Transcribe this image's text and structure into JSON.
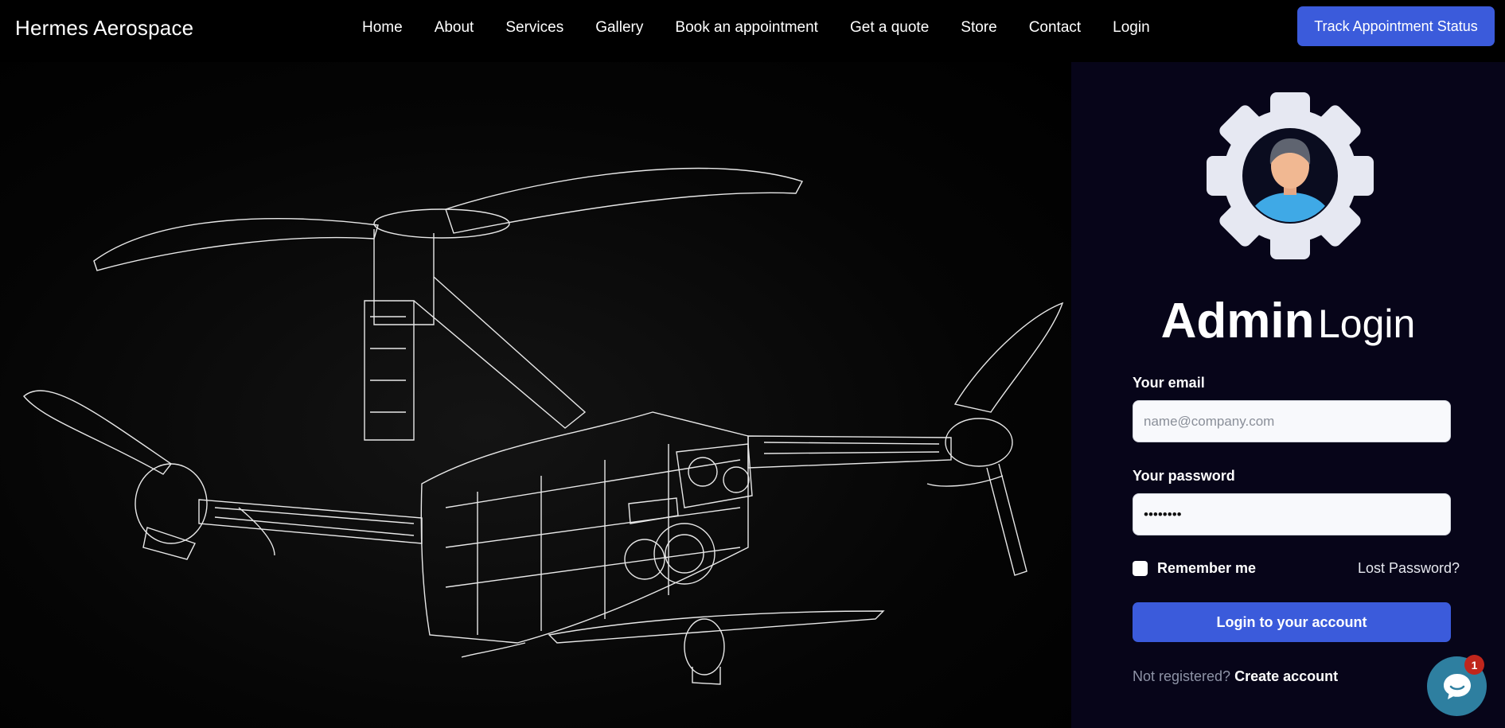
{
  "brand": "Hermes Aerospace",
  "nav": {
    "items": [
      "Home",
      "About",
      "Services",
      "Gallery",
      "Book an appointment",
      "Get a quote",
      "Store",
      "Contact",
      "Login"
    ],
    "track_button": "Track Appointment Status"
  },
  "login": {
    "title_bold": "Admin",
    "title_regular": "Login",
    "email_label": "Your email",
    "email_placeholder": "name@company.com",
    "password_label": "Your password",
    "password_value": "••••••••",
    "remember_label": "Remember me",
    "lost_password": "Lost Password?",
    "submit_label": "Login to your account",
    "not_registered": "Not registered?",
    "create_account": "Create account"
  },
  "chat": {
    "badge_count": "1"
  },
  "icons": {
    "avatar": "gear-avatar-icon",
    "chat": "chat-bubble-icon"
  },
  "colors": {
    "accent": "#3b5bdb",
    "panel_bg": "#070519",
    "chat": "#2e7fa0",
    "badge": "#c0261c"
  }
}
